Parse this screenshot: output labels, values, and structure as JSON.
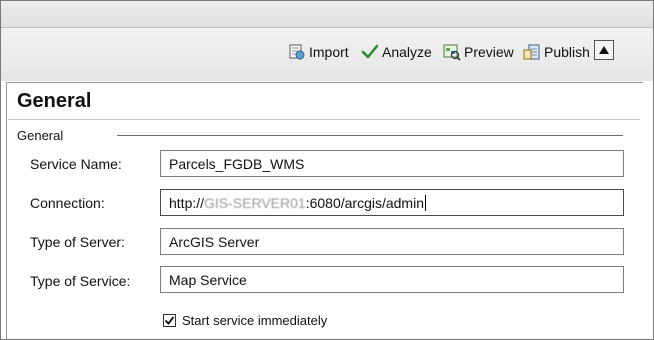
{
  "toolbar": {
    "import_label": "Import",
    "analyze_label": "Analyze",
    "preview_label": "Preview",
    "publish_label": "Publish"
  },
  "general": {
    "heading": "General",
    "group_label": "General",
    "fields": {
      "service_name_label": "Service Name:",
      "service_name_value": "Parcels_FGDB_WMS",
      "connection_label": "Connection:",
      "connection_prefix": "http://",
      "connection_host": "GIS-SERVER01",
      "connection_suffix": ":6080/arcgis/admin",
      "server_type_label": "Type of Server:",
      "server_type_value": "ArcGIS Server",
      "service_type_label": "Type of Service:",
      "service_type_value": "Map Service"
    },
    "start_immediately_label": "Start service immediately",
    "start_immediately_checked": true
  },
  "icons": {
    "import": "import-icon",
    "analyze": "checkmark-icon",
    "preview": "preview-icon",
    "publish": "publish-icon",
    "collapse": "collapse-up-icon"
  },
  "colors": {
    "analyze_check": "#2a8a2a",
    "toolbar_bg": "#ececec"
  }
}
